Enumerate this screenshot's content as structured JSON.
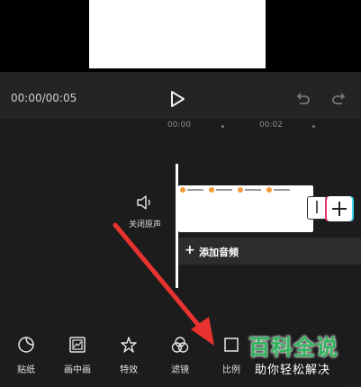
{
  "player": {
    "time_display": "00:00/00:05"
  },
  "ruler": {
    "labels": [
      "00:00",
      "00:02"
    ]
  },
  "track": {
    "mute_label": "关闭原声",
    "audio_plus": "+",
    "audio_label": "添加音频",
    "add_clip_plus": "+"
  },
  "toolbar": {
    "items": [
      {
        "label": "贴纸",
        "icon": "sticker-icon"
      },
      {
        "label": "画中画",
        "icon": "picture-in-picture-icon"
      },
      {
        "label": "特效",
        "icon": "effects-star-icon"
      },
      {
        "label": "滤镜",
        "icon": "filter-circles-icon"
      },
      {
        "label": "比例",
        "icon": "aspect-ratio-icon"
      }
    ]
  },
  "watermark": {
    "line1": "百科全说",
    "line2": "助你轻松解决"
  },
  "colors": {
    "accent_green": "#2fb35c",
    "arrow_red": "#e8322f",
    "clip_pink": "#e9396a",
    "clip_cyan": "#3fd4e7"
  }
}
